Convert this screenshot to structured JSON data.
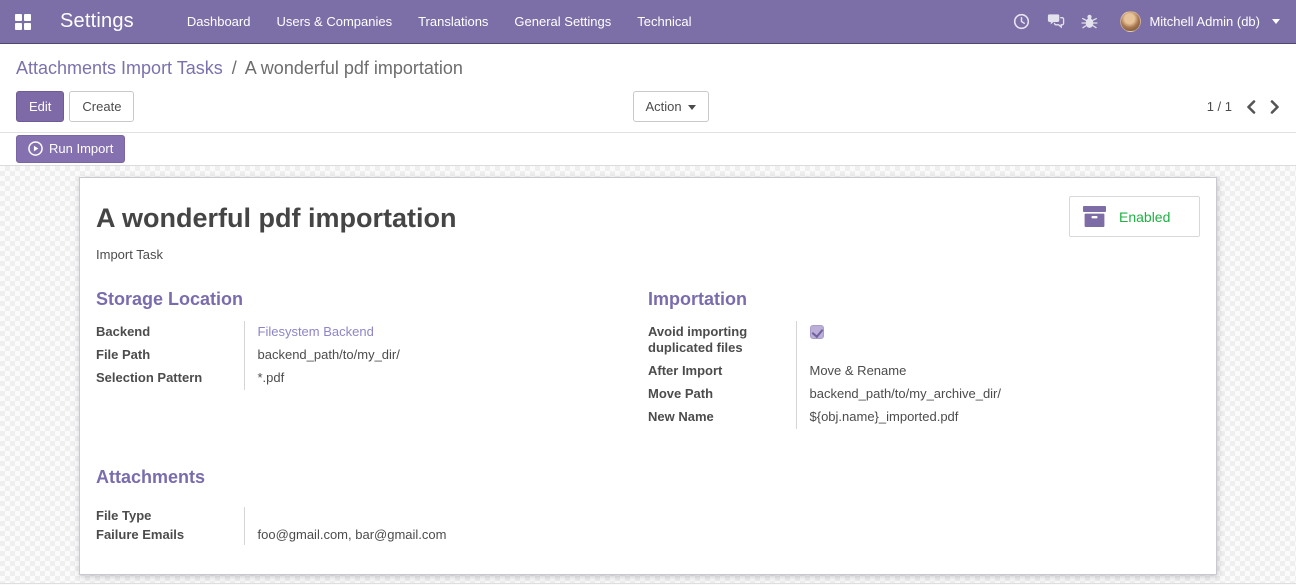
{
  "navbar": {
    "brand": "Settings",
    "menu": [
      "Dashboard",
      "Users & Companies",
      "Translations",
      "General Settings",
      "Technical"
    ],
    "user_name": "Mitchell Admin (db)"
  },
  "breadcrumb": {
    "parent": "Attachments Import Tasks",
    "divider": "/",
    "current": "A wonderful pdf importation"
  },
  "control_panel": {
    "edit_label": "Edit",
    "create_label": "Create",
    "action_label": "Action",
    "pager_value": "1 / 1"
  },
  "statusbar": {
    "run_import_label": "Run Import"
  },
  "sheet": {
    "title": "A wonderful pdf importation",
    "subtitle": "Import Task",
    "enabled_label": "Enabled",
    "groups": [
      {
        "title": "Storage Location",
        "fields": [
          {
            "label": "Backend",
            "value": "Filesystem Backend",
            "type": "link"
          },
          {
            "label": "File Path",
            "value": "backend_path/to/my_dir/",
            "type": "text"
          },
          {
            "label": "Selection Pattern",
            "value": "*.pdf",
            "type": "text"
          }
        ]
      },
      {
        "title": "Importation",
        "fields": [
          {
            "label": "Avoid importing duplicated files",
            "type": "checkbox",
            "checked": true
          },
          {
            "label": "After Import",
            "value": "Move & Rename",
            "type": "text"
          },
          {
            "label": "Move Path",
            "value": "backend_path/to/my_archive_dir/",
            "type": "text"
          },
          {
            "label": "New Name",
            "value": "${obj.name}_imported.pdf",
            "type": "text"
          }
        ]
      },
      {
        "title": "Attachments",
        "fields": [
          {
            "label": "File Type",
            "value": "",
            "type": "text"
          },
          {
            "label": "Failure Emails",
            "value": "foo@gmail.com, bar@gmail.com",
            "type": "text"
          }
        ]
      }
    ]
  },
  "colors": {
    "navbar_bg": "#7C6EA7",
    "primary_button": "#7E6AA7",
    "run_button": "#8571B0",
    "link_purple": "#7C71AD",
    "section_title": "#7A6CAD",
    "enabled_green": "#1FB144"
  }
}
